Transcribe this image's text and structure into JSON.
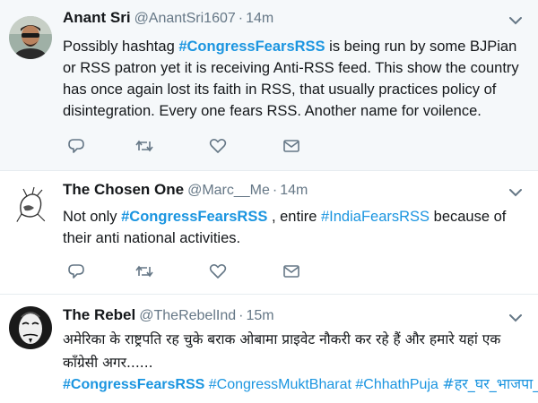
{
  "tweets": [
    {
      "name": "Anant Sri",
      "handle": "@AnantSri1607",
      "separator": "·",
      "time": "14m",
      "text_hashtag": "#CongressFearsRSS",
      "text_before": "Possibly hashtag ",
      "text_after": " is being run by some BJPian or RSS patron yet it is receiving Anti-RSS feed. This show the country has once again lost its faith in RSS, that usually practices policy of disintegration. Every one fears RSS. Another name for voilence."
    },
    {
      "name": "The Chosen One",
      "handle": "@Marc__Me",
      "separator": "·",
      "time": "14m",
      "text_before": "Not only ",
      "text_hashtag1": "#CongressFearsRSS",
      "text_middle": " , entire ",
      "text_hashtag2": "#IndiaFearsRSS",
      "text_after": " because of their anti national activities."
    },
    {
      "name": "The Rebel",
      "handle": "@TheRebelInd",
      "separator": "·",
      "time": "15m",
      "text": "अमेरिका के राष्ट्रपति रह चुके बराक ओबामा प्राइवेट नौकरी कर रहे हैं और हमारे यहां एक कॉंग्रेसी अगर......",
      "hashtags": [
        "#CongressFearsRSS",
        "#CongressMuktBharat",
        "#ChhathPuja",
        "#हर_घर_भाजपा_ध्वज"
      ]
    }
  ],
  "icons": {
    "reply": "reply-icon",
    "retweet": "retweet-icon",
    "like": "heart-icon",
    "message": "direct-message-icon",
    "caret": "chevron-down-icon"
  },
  "colors": {
    "link": "#1b95e0",
    "icon": "#657786",
    "highlight_bg": "#f5f8fa",
    "text": "#14171a"
  }
}
